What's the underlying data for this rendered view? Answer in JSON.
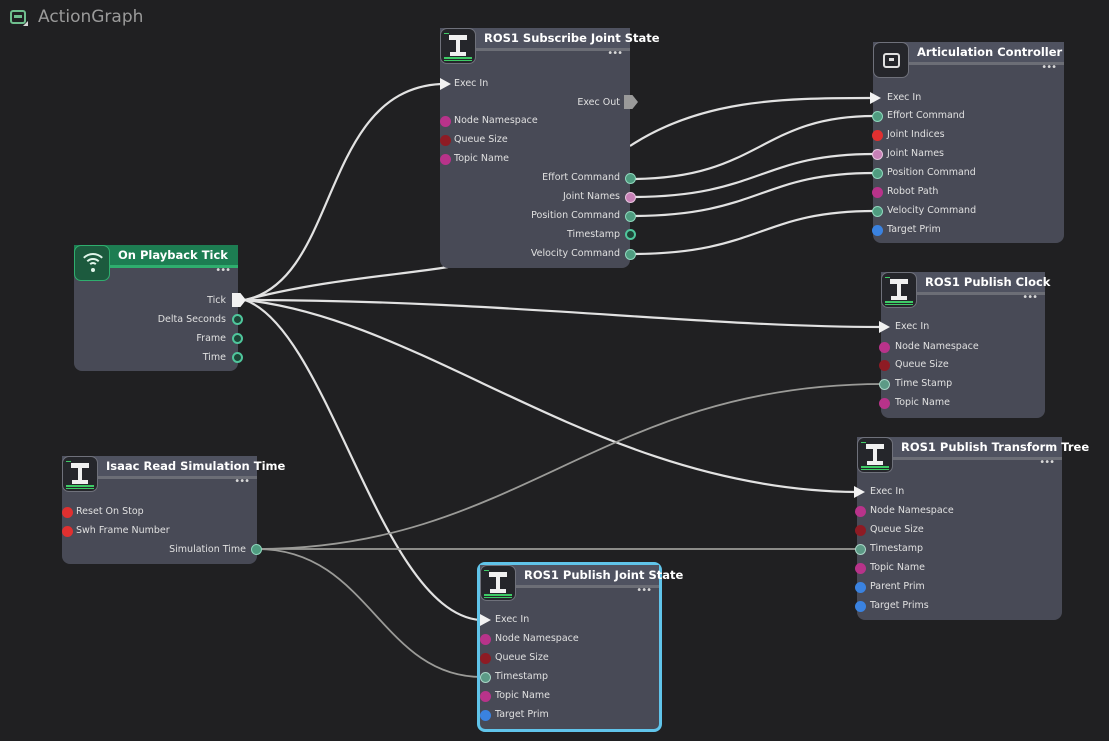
{
  "graph": {
    "title": "ActionGraph"
  },
  "nodes": {
    "playback": {
      "title": "On Playback Tick",
      "ports": [
        "Tick",
        "Delta Seconds",
        "Frame",
        "Time"
      ]
    },
    "read_sim": {
      "title": "Isaac Read Simulation Time",
      "ports": [
        "Reset On Stop",
        "Swh Frame Number",
        "Simulation Time"
      ]
    },
    "sub_joint": {
      "title": "ROS1 Subscribe Joint State",
      "ports": [
        "Exec In",
        "Exec Out",
        "Node Namespace",
        "Queue Size",
        "Topic Name",
        "Effort Command",
        "Joint Names",
        "Position Command",
        "Timestamp",
        "Velocity Command"
      ]
    },
    "artic": {
      "title": "Articulation Controller",
      "ports": [
        "Exec In",
        "Effort Command",
        "Joint Indices",
        "Joint Names",
        "Position Command",
        "Robot Path",
        "Velocity Command",
        "Target Prim"
      ]
    },
    "pub_clock": {
      "title": "ROS1 Publish Clock",
      "ports": [
        "Exec In",
        "Node Namespace",
        "Queue Size",
        "Time Stamp",
        "Topic Name"
      ]
    },
    "pub_tf": {
      "title": "ROS1 Publish Transform Tree",
      "ports": [
        "Exec In",
        "Node Namespace",
        "Queue Size",
        "Timestamp",
        "Topic Name",
        "Parent Prim",
        "Target Prims"
      ]
    },
    "pub_joint": {
      "title": "ROS1 Publish Joint State",
      "ports": [
        "Exec In",
        "Node Namespace",
        "Queue Size",
        "Timestamp",
        "Topic Name",
        "Target Prim"
      ]
    }
  },
  "icons": {
    "graph": "action-graph-icon",
    "playback": "wifi-icon",
    "ros": "robot-arm-icon",
    "artic": "articulation-icon",
    "menu": "more-dots-icon"
  },
  "colors": {
    "background": "#202022",
    "node_body": "#484a56",
    "playback_header": "#1d7d52",
    "selection": "#60c4ea",
    "wire": "#e2e2e2"
  }
}
